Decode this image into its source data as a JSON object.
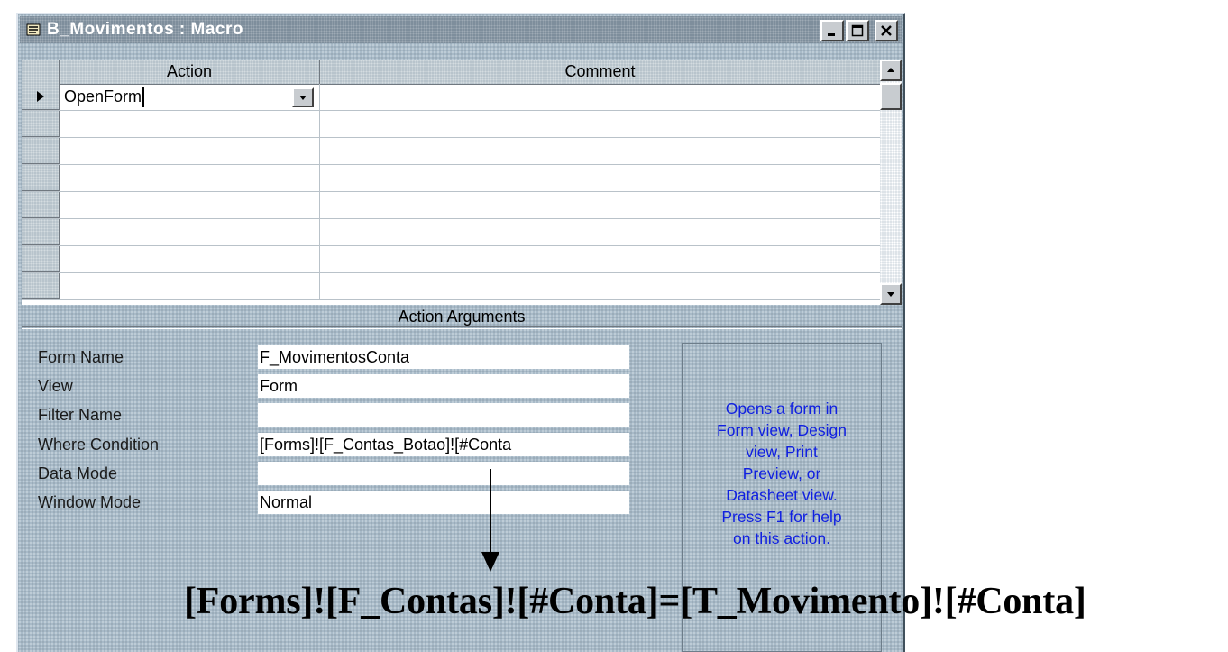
{
  "window": {
    "title": "B_Movimentos : Macro",
    "controls": [
      "minimize",
      "maximize",
      "close"
    ]
  },
  "grid": {
    "columns": [
      "Action",
      "Comment"
    ],
    "rows": [
      {
        "action": "OpenForm",
        "comment": "",
        "current": true
      },
      {
        "action": "",
        "comment": ""
      },
      {
        "action": "",
        "comment": ""
      },
      {
        "action": "",
        "comment": ""
      },
      {
        "action": "",
        "comment": ""
      },
      {
        "action": "",
        "comment": ""
      },
      {
        "action": "",
        "comment": ""
      },
      {
        "action": "",
        "comment": ""
      }
    ]
  },
  "arguments": {
    "header": "Action Arguments",
    "fields": [
      {
        "label": "Form Name",
        "value": "F_MovimentosConta"
      },
      {
        "label": "View",
        "value": "Form"
      },
      {
        "label": "Filter Name",
        "value": ""
      },
      {
        "label": "Where Condition",
        "value": "[Forms]![F_Contas_Botao]![#Conta"
      },
      {
        "label": "Data Mode",
        "value": ""
      },
      {
        "label": "Window Mode",
        "value": "Normal"
      }
    ],
    "help": "Opens a form in\nForm view, Design\nview, Print\nPreview, or\nDatasheet view.\nPress F1 for help\non this action."
  },
  "annotation": "[Forms]![F_Contas]![#Conta]=[T_Movimento]![#Conta]",
  "icons": {
    "title": "macro-scroll-icon",
    "row_indicator": "current-row-arrow-icon",
    "combo": "chevron-down-icon"
  }
}
